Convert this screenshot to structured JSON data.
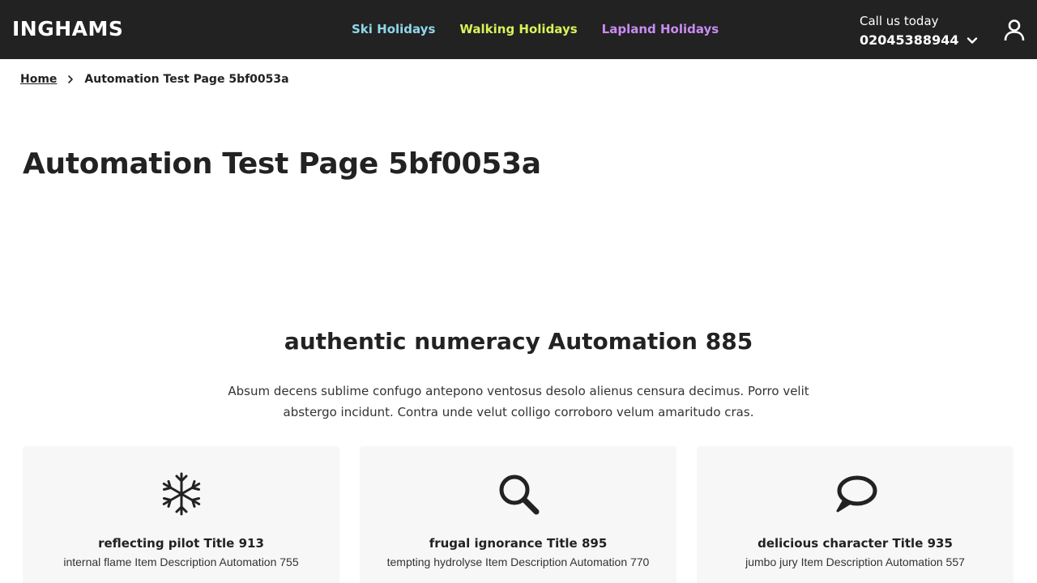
{
  "header": {
    "logo": "INGHAMS",
    "nav": [
      {
        "label": "Ski Holidays",
        "color": "#8fd6ea"
      },
      {
        "label": "Walking Holidays",
        "color": "#d8f25a"
      },
      {
        "label": "Lapland Holidays",
        "color": "#c98cf2"
      }
    ],
    "call_label": "Call us today",
    "call_number": "02045388944",
    "background": "#222222"
  },
  "breadcrumb": {
    "home": "Home",
    "current": "Automation Test Page 5bf0053a"
  },
  "page_title": "Automation Test Page 5bf0053a",
  "section": {
    "title": "authentic numeracy Automation 885",
    "intro": "Absum decens sublime confugo antepono ventosus desolo alienus censura decimus. Porro velit abstergo incidunt. Contra unde velut colligo corroboro velum amaritudo cras."
  },
  "cards": [
    {
      "icon": "snowflake-icon",
      "title": "reflecting pilot Title 913",
      "description": "internal flame Item Description Automation 755"
    },
    {
      "icon": "search-icon",
      "title": "frugal ignorance Title 895",
      "description": "tempting hydrolyse Item Description Automation 770"
    },
    {
      "icon": "speech-bubble-icon",
      "title": "delicious character Title 935",
      "description": "jumbo jury Item Description Automation 557"
    }
  ]
}
